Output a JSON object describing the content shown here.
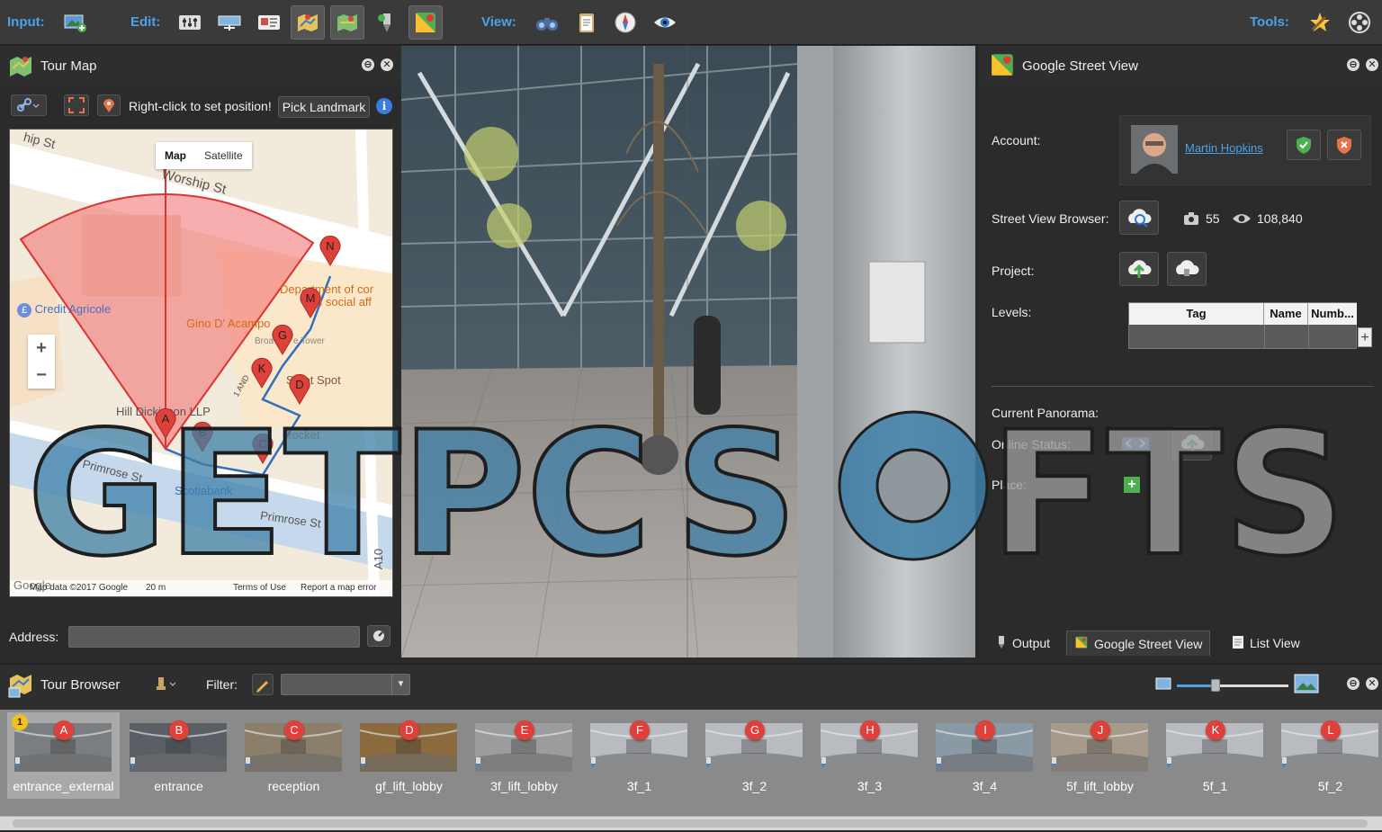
{
  "toolbar": {
    "input_label": "Input:",
    "edit_label": "Edit:",
    "view_label": "View:",
    "tools_label": "Tools:"
  },
  "tour_map": {
    "title": "Tour Map",
    "hint": "Right-click to set position!",
    "pick_landmark": "Pick Landmark",
    "map_type_map": "Map",
    "map_type_satellite": "Satellite",
    "zoom_in": "+",
    "zoom_out": "−",
    "footer": {
      "data": "Map data ©2017 Google",
      "scale": "20 m",
      "terms": "Terms of Use",
      "report": "Report a map error",
      "google": "Google"
    },
    "labels": {
      "worship_st": "Worship St",
      "top_st": "hip St",
      "credit_agricole": "Credit Agricole",
      "dept": "Department of cor",
      "dept2": "d social aff",
      "gino": "Gino D' Acampo",
      "broad": "Broa",
      "tower": "e Tower",
      "sweet": "S   eet Spot",
      "hill": "Hill Dickinson LLP",
      "rocket": "Rocket",
      "primrose1": "Primrose St",
      "primrose2": "Primrose St",
      "scotiabank": "Scotiabank",
      "a10": "A10",
      "land": "1 AND"
    },
    "markers": [
      "A",
      "B",
      "C",
      "D",
      "G",
      "K",
      "M",
      "N"
    ],
    "address_label": "Address:",
    "address_value": ""
  },
  "street_view": {
    "title": "Google Street View",
    "account_label": "Account:",
    "account_name": "Martin Hopkins",
    "browser_label": "Street View Browser:",
    "photo_count": "55",
    "view_count": "108,840",
    "project_label": "Project:",
    "levels_label": "Levels:",
    "levels_columns": [
      "Tag",
      "Name",
      "Numb..."
    ],
    "current_panorama_label": "Current Panorama:",
    "online_status_label": "Online Status:",
    "place_label": "Place:",
    "tabs": [
      "Output",
      "Google Street View",
      "List View"
    ]
  },
  "tour_browser": {
    "title": "Tour Browser",
    "filter_label": "Filter:",
    "filter_value": "",
    "zoom_level": 0.35,
    "selected_badge": "1",
    "thumbnails": [
      {
        "letter": "A",
        "name": "entrance_external"
      },
      {
        "letter": "B",
        "name": "entrance"
      },
      {
        "letter": "C",
        "name": "reception"
      },
      {
        "letter": "D",
        "name": "gf_lift_lobby"
      },
      {
        "letter": "E",
        "name": "3f_lift_lobby"
      },
      {
        "letter": "F",
        "name": "3f_1"
      },
      {
        "letter": "G",
        "name": "3f_2"
      },
      {
        "letter": "H",
        "name": "3f_3"
      },
      {
        "letter": "I",
        "name": "3f_4"
      },
      {
        "letter": "J",
        "name": "5f_lift_lobby"
      },
      {
        "letter": "K",
        "name": "5f_1"
      },
      {
        "letter": "L",
        "name": "5f_2"
      }
    ]
  },
  "watermark": "GETPCSOFTS",
  "colors": {
    "accent": "#4aa3e8",
    "marker": "#e0403a",
    "fov": "#f26b6b"
  }
}
